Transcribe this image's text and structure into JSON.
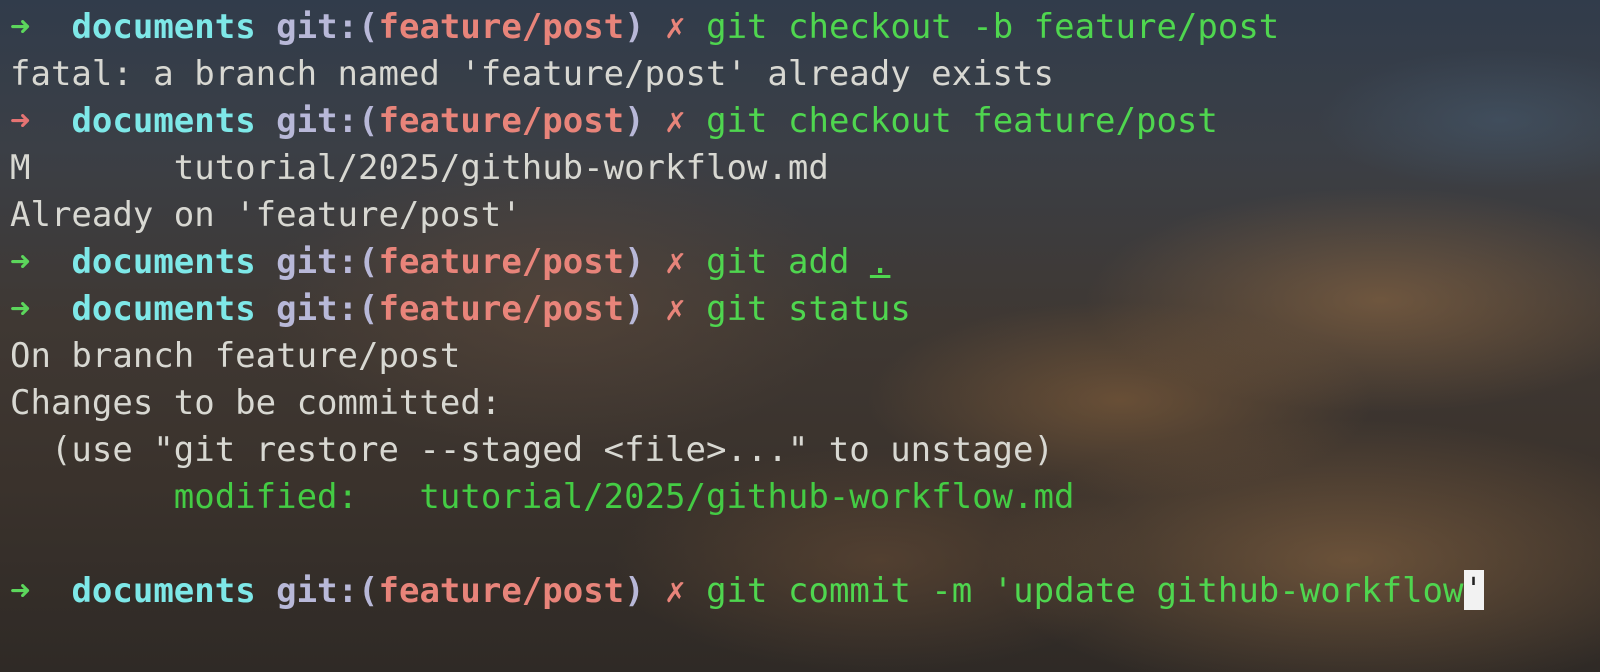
{
  "prompt": {
    "arrow": "➜",
    "directory": "documents",
    "git_label": "git:(",
    "branch": "feature/post",
    "git_close": ")",
    "dirty_mark": "✗"
  },
  "lines": [
    {
      "type": "prompt",
      "status": "ok",
      "cmd": "git",
      "args": "checkout -b feature/post"
    },
    {
      "type": "output",
      "text": "fatal: a branch named 'feature/post' already exists"
    },
    {
      "type": "prompt",
      "status": "error",
      "cmd": "git",
      "args": "checkout feature/post"
    },
    {
      "type": "output",
      "text": "M       tutorial/2025/github-workflow.md"
    },
    {
      "type": "output",
      "text": "Already on 'feature/post'"
    },
    {
      "type": "prompt",
      "status": "ok",
      "cmd": "git",
      "args": "add",
      "args_underlined": "."
    },
    {
      "type": "prompt",
      "status": "ok",
      "cmd": "git",
      "args": "status"
    },
    {
      "type": "output",
      "text": "On branch feature/post"
    },
    {
      "type": "output",
      "text": "Changes to be committed:"
    },
    {
      "type": "output",
      "text": "  (use \"git restore --staged <file>...\" to unstage)"
    },
    {
      "type": "modified",
      "label": "        modified:",
      "path": "   tutorial/2025/github-workflow.md"
    },
    {
      "type": "blank",
      "text": ""
    },
    {
      "type": "prompt",
      "status": "ok",
      "cmd": "git",
      "args": "commit -m 'update github-workflow",
      "cursor_char": "'"
    }
  ],
  "colors": {
    "arrow_ok": "#5cd65c",
    "arrow_error": "#e57373",
    "directory": "#7ee8e8",
    "branch": "#e8847a",
    "command": "#4fd64f",
    "output": "#d8d8d2"
  }
}
